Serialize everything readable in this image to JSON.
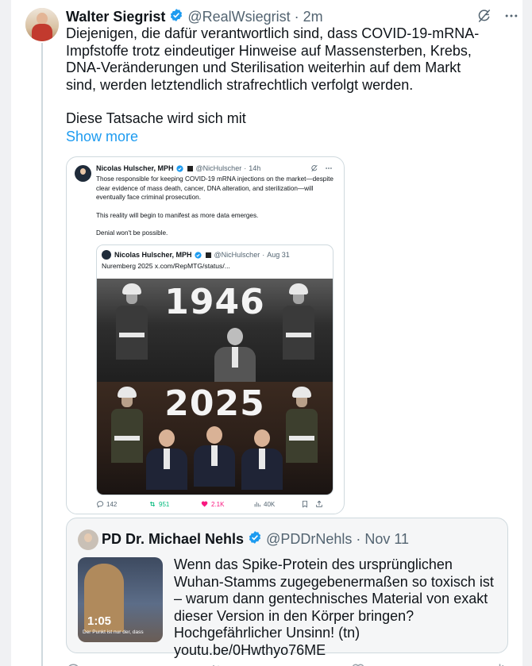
{
  "tweet": {
    "author_name": "Walter Siegrist",
    "handle": "@RealWsiegrist",
    "separator": "·",
    "time": "2m",
    "text_p1": "Diejenigen, die dafür verantwortlich sind, dass COVID-19-mRNA-Impfstoffe trotz eindeutiger Hinweise auf Massensterben, Krebs, DNA-Veränderungen und Sterilisation weiterhin auf dem Markt sind, werden letztendlich strafrechtlich verfolgt werden.",
    "text_p2": "Diese Tatsache wird sich mit",
    "show_more": "Show more"
  },
  "embedded": {
    "author_name": "Nicolas Hulscher, MPH",
    "handle": "@NicHulscher",
    "separator": "·",
    "time": "14h",
    "text_p1": "Those responsible for keeping COVID-19 mRNA injections on the market—despite clear evidence of mass death, cancer, DNA alteration, and sterilization—will eventually face criminal prosecution.",
    "text_p2": "This reality will begin to manifest as more data emerges.",
    "text_p3": "Denial won't be possible.",
    "quote": {
      "author_name": "Nicolas Hulscher, MPH",
      "handle": "@NicHulscher",
      "separator": "·",
      "time": "Aug 31",
      "text": "Nuremberg 2025  x.com/RepMTG/status/...",
      "year_top": "1946",
      "year_bottom": "2025"
    },
    "actions": {
      "replies": "142",
      "reposts": "951",
      "likes": "2.1K",
      "views": "40K"
    }
  },
  "quoted": {
    "author_name": "PD Dr. Michael Nehls",
    "handle": "@PDDrNehls",
    "separator": "·",
    "time": "Nov 11",
    "video_duration": "1:05",
    "video_caption": "Der Punkt ist nur der, dass",
    "text": "Wenn das Spike-Protein des ursprünglichen Wuhan-Stamms zugegebenermaßen so toxisch ist – warum dann gentechnisches Material von exakt dieser Version in den Körper bringen? Hochgefährlicher Unsinn! (tn) youtu.be/0Hwthyo76ME"
  },
  "icons": {
    "verified": "verified-badge-icon",
    "grok": "grok-icon",
    "more": "more-icon",
    "reply": "reply-icon",
    "repost": "repost-icon",
    "like": "heart-icon",
    "views": "views-icon",
    "bookmark": "bookmark-icon",
    "share": "share-icon"
  },
  "colors": {
    "accent": "#1d9bf0",
    "repost": "#00ba7c",
    "like": "#f91880",
    "muted": "#536471"
  }
}
